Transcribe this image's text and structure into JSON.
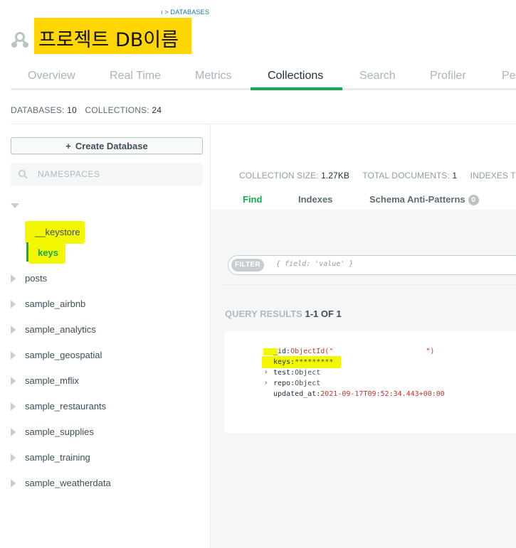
{
  "breadcrumb": "ı > DATABASES",
  "project_title": "프로젝트 DB이름",
  "tabs": [
    {
      "label": "Overview",
      "active": false
    },
    {
      "label": "Real Time",
      "active": false
    },
    {
      "label": "Metrics",
      "active": false
    },
    {
      "label": "Collections",
      "active": true
    },
    {
      "label": "Search",
      "active": false
    },
    {
      "label": "Profiler",
      "active": false
    },
    {
      "label": "Per",
      "active": false
    }
  ],
  "stats": {
    "databases_label": "DATABASES:",
    "databases_value": "10",
    "collections_label": "COLLECTIONS:",
    "collections_value": "24"
  },
  "sidebar": {
    "create_button": "Create Database",
    "create_icon": "+",
    "search_placeholder": "NAMESPACES",
    "collections": [
      "__keystore",
      "keys"
    ],
    "databases": [
      "posts",
      "sample_airbnb",
      "sample_analytics",
      "sample_geospatial",
      "sample_mflix",
      "sample_restaurants",
      "sample_supplies",
      "sample_training",
      "sample_weatherdata"
    ]
  },
  "collection_stats": {
    "size_label": "COLLECTION SIZE:",
    "size_value": "1.27KB",
    "docs_label": "TOTAL DOCUMENTS:",
    "docs_value": "1",
    "indexes_label": "INDEXES TO"
  },
  "subtabs": {
    "find": "Find",
    "indexes": "Indexes",
    "schema": "Schema Anti-Patterns",
    "schema_badge": "0"
  },
  "filter": {
    "pill": "FILTER",
    "placeholder": "{ field: 'value' }"
  },
  "query_results": {
    "label": "QUERY RESULTS",
    "value": "1-1 OF 1"
  },
  "document": {
    "id_key": "_id:",
    "id_value_open": "ObjectId(\"",
    "id_value_close": "\")",
    "keys_key": "keys:",
    "keys_value": "*********",
    "test_key": "test:",
    "test_value": "Object",
    "repo_key": "repo:",
    "repo_value": "Object",
    "updated_key": "updated_at:",
    "updated_value": "2021-09-17T09:52:34.443+00:00",
    "expand_glyph": "›"
  },
  "colors": {
    "accent_green": "#13aa52",
    "highlight_yellow": "#f3f800",
    "title_highlight": "#ffd600"
  }
}
